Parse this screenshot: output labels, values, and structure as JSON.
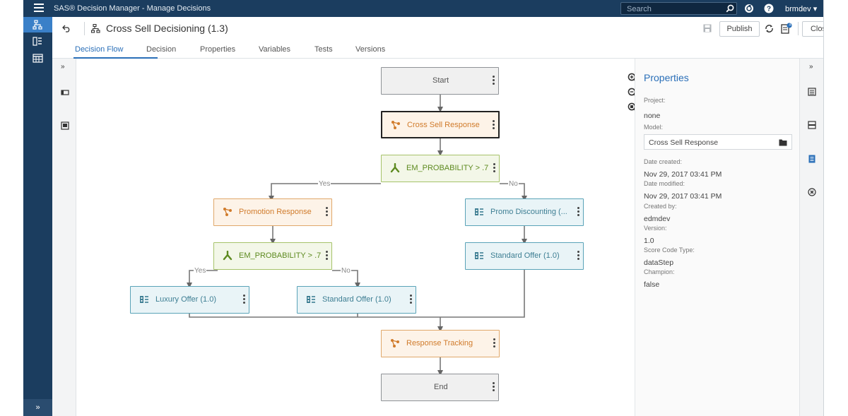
{
  "titlebar": {
    "app_title": "SAS® Decision Manager - Manage Decisions",
    "search_placeholder": "Search",
    "user": "brmdev ▾"
  },
  "header": {
    "doc_title": "Cross Sell Decisioning (1.3)",
    "publish_label": "Publish",
    "close_label": "Close",
    "notification_count": "1"
  },
  "tabs": [
    {
      "label": "Decision Flow",
      "active": true
    },
    {
      "label": "Decision"
    },
    {
      "label": "Properties"
    },
    {
      "label": "Variables"
    },
    {
      "label": "Tests"
    },
    {
      "label": "Versions"
    }
  ],
  "leftnav": {
    "expand_label": "»"
  },
  "lefttools": {
    "expand_label": "»"
  },
  "righttools": {
    "expand_label": "»"
  },
  "flow": {
    "start": "Start",
    "cross_sell": "Cross Sell Response",
    "cond1": "EM_PROBABILITY > .7",
    "yes1": "Yes",
    "no1": "No",
    "promotion": "Promotion Response",
    "promo_discount": "Promo Discounting (...",
    "cond2": "EM_PROBABILITY > .7",
    "standard_offer_right": "Standard Offer (1.0)",
    "yes2": "Yes",
    "no2": "No",
    "luxury": "Luxury Offer (1.0)",
    "standard_offer_mid": "Standard Offer (1.0)",
    "response_tracking": "Response Tracking",
    "end": "End"
  },
  "properties": {
    "title": "Properties",
    "project_label": "Project:",
    "project_value": "none",
    "model_label": "Model:",
    "model_value": "Cross Sell Response",
    "date_created_label": "Date created:",
    "date_created_value": "Nov 29, 2017 03:41 PM",
    "date_modified_label": "Date modified:",
    "date_modified_value": "Nov 29, 2017 03:41 PM",
    "created_by_label": "Created by:",
    "created_by_value": "edmdev",
    "version_label": "Version:",
    "version_value": "1.0",
    "score_code_label": "Score Code Type:",
    "score_code_value": "dataStep",
    "champion_label": "Champion:",
    "champion_value": "false"
  },
  "colors": {
    "titlebar_bg": "#1b3d5f",
    "accent": "#2a6fb8",
    "node_orange": "#d07b2b",
    "node_green": "#5d8a1f",
    "node_teal": "#3d7e93"
  }
}
